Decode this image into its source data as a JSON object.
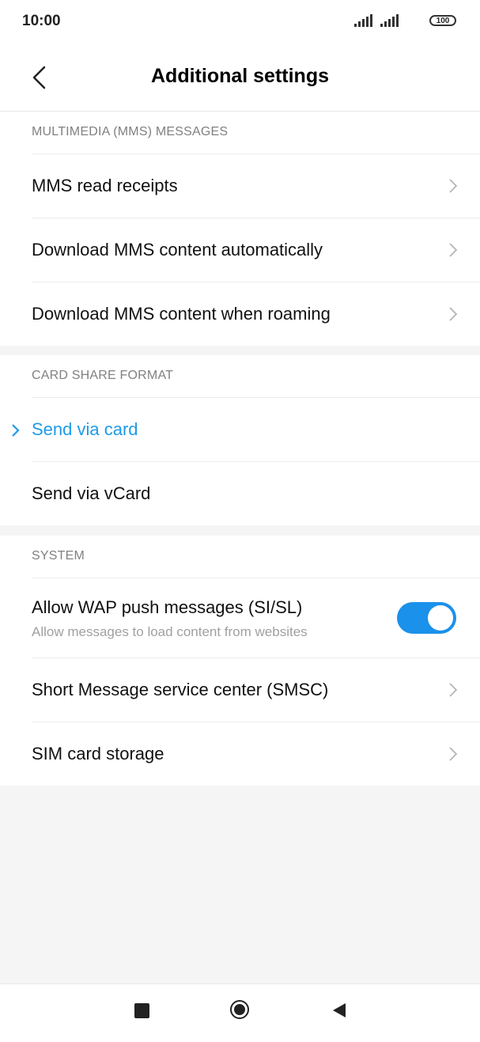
{
  "status": {
    "time": "10:00",
    "battery": "100"
  },
  "header": {
    "title": "Additional settings"
  },
  "sections": {
    "mms": {
      "header": "MULTIMEDIA (MMS) MESSAGES",
      "items": [
        {
          "label": "MMS read receipts"
        },
        {
          "label": "Download MMS content automatically"
        },
        {
          "label": "Download MMS content when roaming"
        }
      ]
    },
    "card": {
      "header": "CARD SHARE FORMAT",
      "items": [
        {
          "label": "Send via card",
          "selected": true
        },
        {
          "label": "Send via vCard",
          "selected": false
        }
      ]
    },
    "system": {
      "header": "SYSTEM",
      "wap": {
        "label": "Allow WAP push messages (SI/SL)",
        "sublabel": "Allow messages to load content from websites",
        "enabled": true
      },
      "items": [
        {
          "label": "Short Message service center (SMSC)"
        },
        {
          "label": "SIM card storage"
        }
      ]
    }
  },
  "colors": {
    "accent": "#1e9be8",
    "toggle_on": "#1a91ea",
    "background": "#f5f5f5"
  },
  "icons": {
    "back": "chevron-left-icon",
    "chevron": "chevron-right-icon",
    "selected": "check-chevron-icon",
    "nav": [
      "square-icon",
      "circle-home-icon",
      "triangle-back-icon"
    ]
  }
}
